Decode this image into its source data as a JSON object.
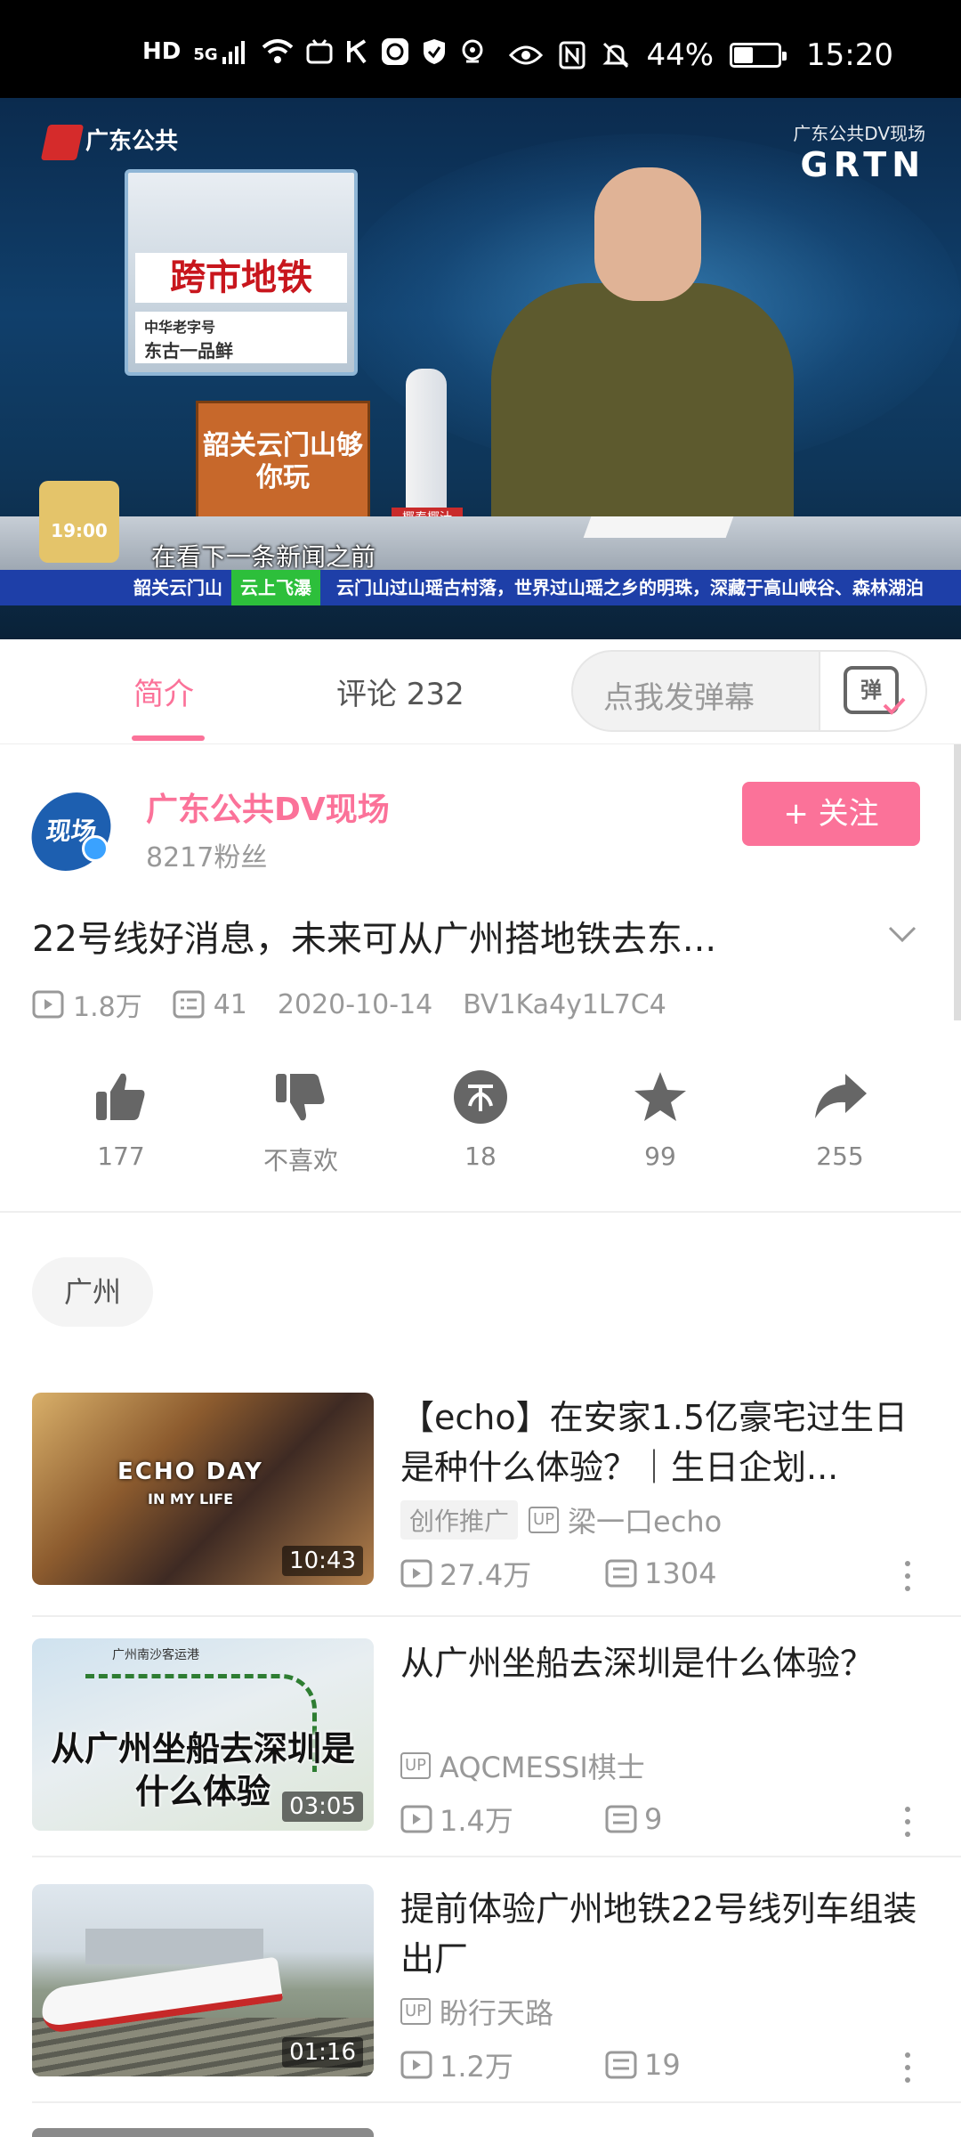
{
  "status_bar": {
    "left_icons": [
      "hd-icon",
      "5g-signal-icon",
      "wifi-icon",
      "bilibili-tv-icon",
      "k-icon",
      "app-icon",
      "shield-icon",
      "notification-icon"
    ],
    "hd_label": "HD",
    "net_label": "5G",
    "battery_percent": "44%",
    "battery_level": 0.44,
    "time": "15:20"
  },
  "player": {
    "channel_logo": "广东公共",
    "corner_logo_small": "广东公共DV现场",
    "corner_logo_big": "GRTN",
    "screen_headline": "跨市地铁",
    "screen_ad_line1": "中华老字号",
    "screen_ad_line2": "东古一品鲜",
    "box_text": "韶关云门山够你玩",
    "bottle_label": "椰泰椰汁",
    "clock_text": "19:00",
    "subtitle": "在看下一条新闻之前",
    "ticker_tag1": "韶关云门山",
    "ticker_tag2": "云上飞瀑",
    "ticker_text": "云门山过山瑶古村落，世界过山瑶之乡的明珠，深藏于高山峡谷、森林湖泊"
  },
  "tabs": {
    "intro": "简介",
    "comments": "评论 232",
    "danmaku_placeholder": "点我发弹幕",
    "danmaku_icon_text": "弹"
  },
  "uploader": {
    "name": "广东公共DV现场",
    "fans": "8217粉丝",
    "avatar_text": "现场",
    "follow_label": "+ 关注"
  },
  "video": {
    "title": "22号线好消息，未来可从广州搭地铁去东...",
    "views": "1.8万",
    "danmaku_count": "41",
    "date": "2020-10-14",
    "bvid": "BV1Ka4y1L7C4"
  },
  "actions": [
    {
      "icon": "thumbs-up-icon",
      "label": "177"
    },
    {
      "icon": "thumbs-down-icon",
      "label": "不喜欢"
    },
    {
      "icon": "coin-icon",
      "label": "18"
    },
    {
      "icon": "star-icon",
      "label": "99"
    },
    {
      "icon": "share-icon",
      "label": "255"
    }
  ],
  "tag": "广州",
  "related": [
    {
      "title": "【echo】在安家1.5亿豪宅过生日是种什么体验？｜生日企划...",
      "promo": "创作推广",
      "up_tag": "UP",
      "up": "梁一口echo",
      "views": "27.4万",
      "danmaku": "1304",
      "duration": "10:43",
      "thumb_text": "ECHO DAY",
      "thumb_sub": "IN MY LIFE"
    },
    {
      "title": "从广州坐船去深圳是什么体验？",
      "up_tag": "UP",
      "up": "AQCMESSI棋士",
      "views": "1.4万",
      "danmaku": "9",
      "duration": "03:05",
      "thumb_text": "从广州坐船去深圳是什么体验",
      "thumb_map_label": "广州南沙客运港"
    },
    {
      "title": "提前体验广州地铁22号线列车组装出厂",
      "up_tag": "UP",
      "up": "盼行天路",
      "views": "1.2万",
      "danmaku": "19",
      "duration": "01:16"
    }
  ],
  "colors": {
    "accent": "#fb7299",
    "muted": "#999999",
    "ticker_blue": "#1e3fa8"
  }
}
